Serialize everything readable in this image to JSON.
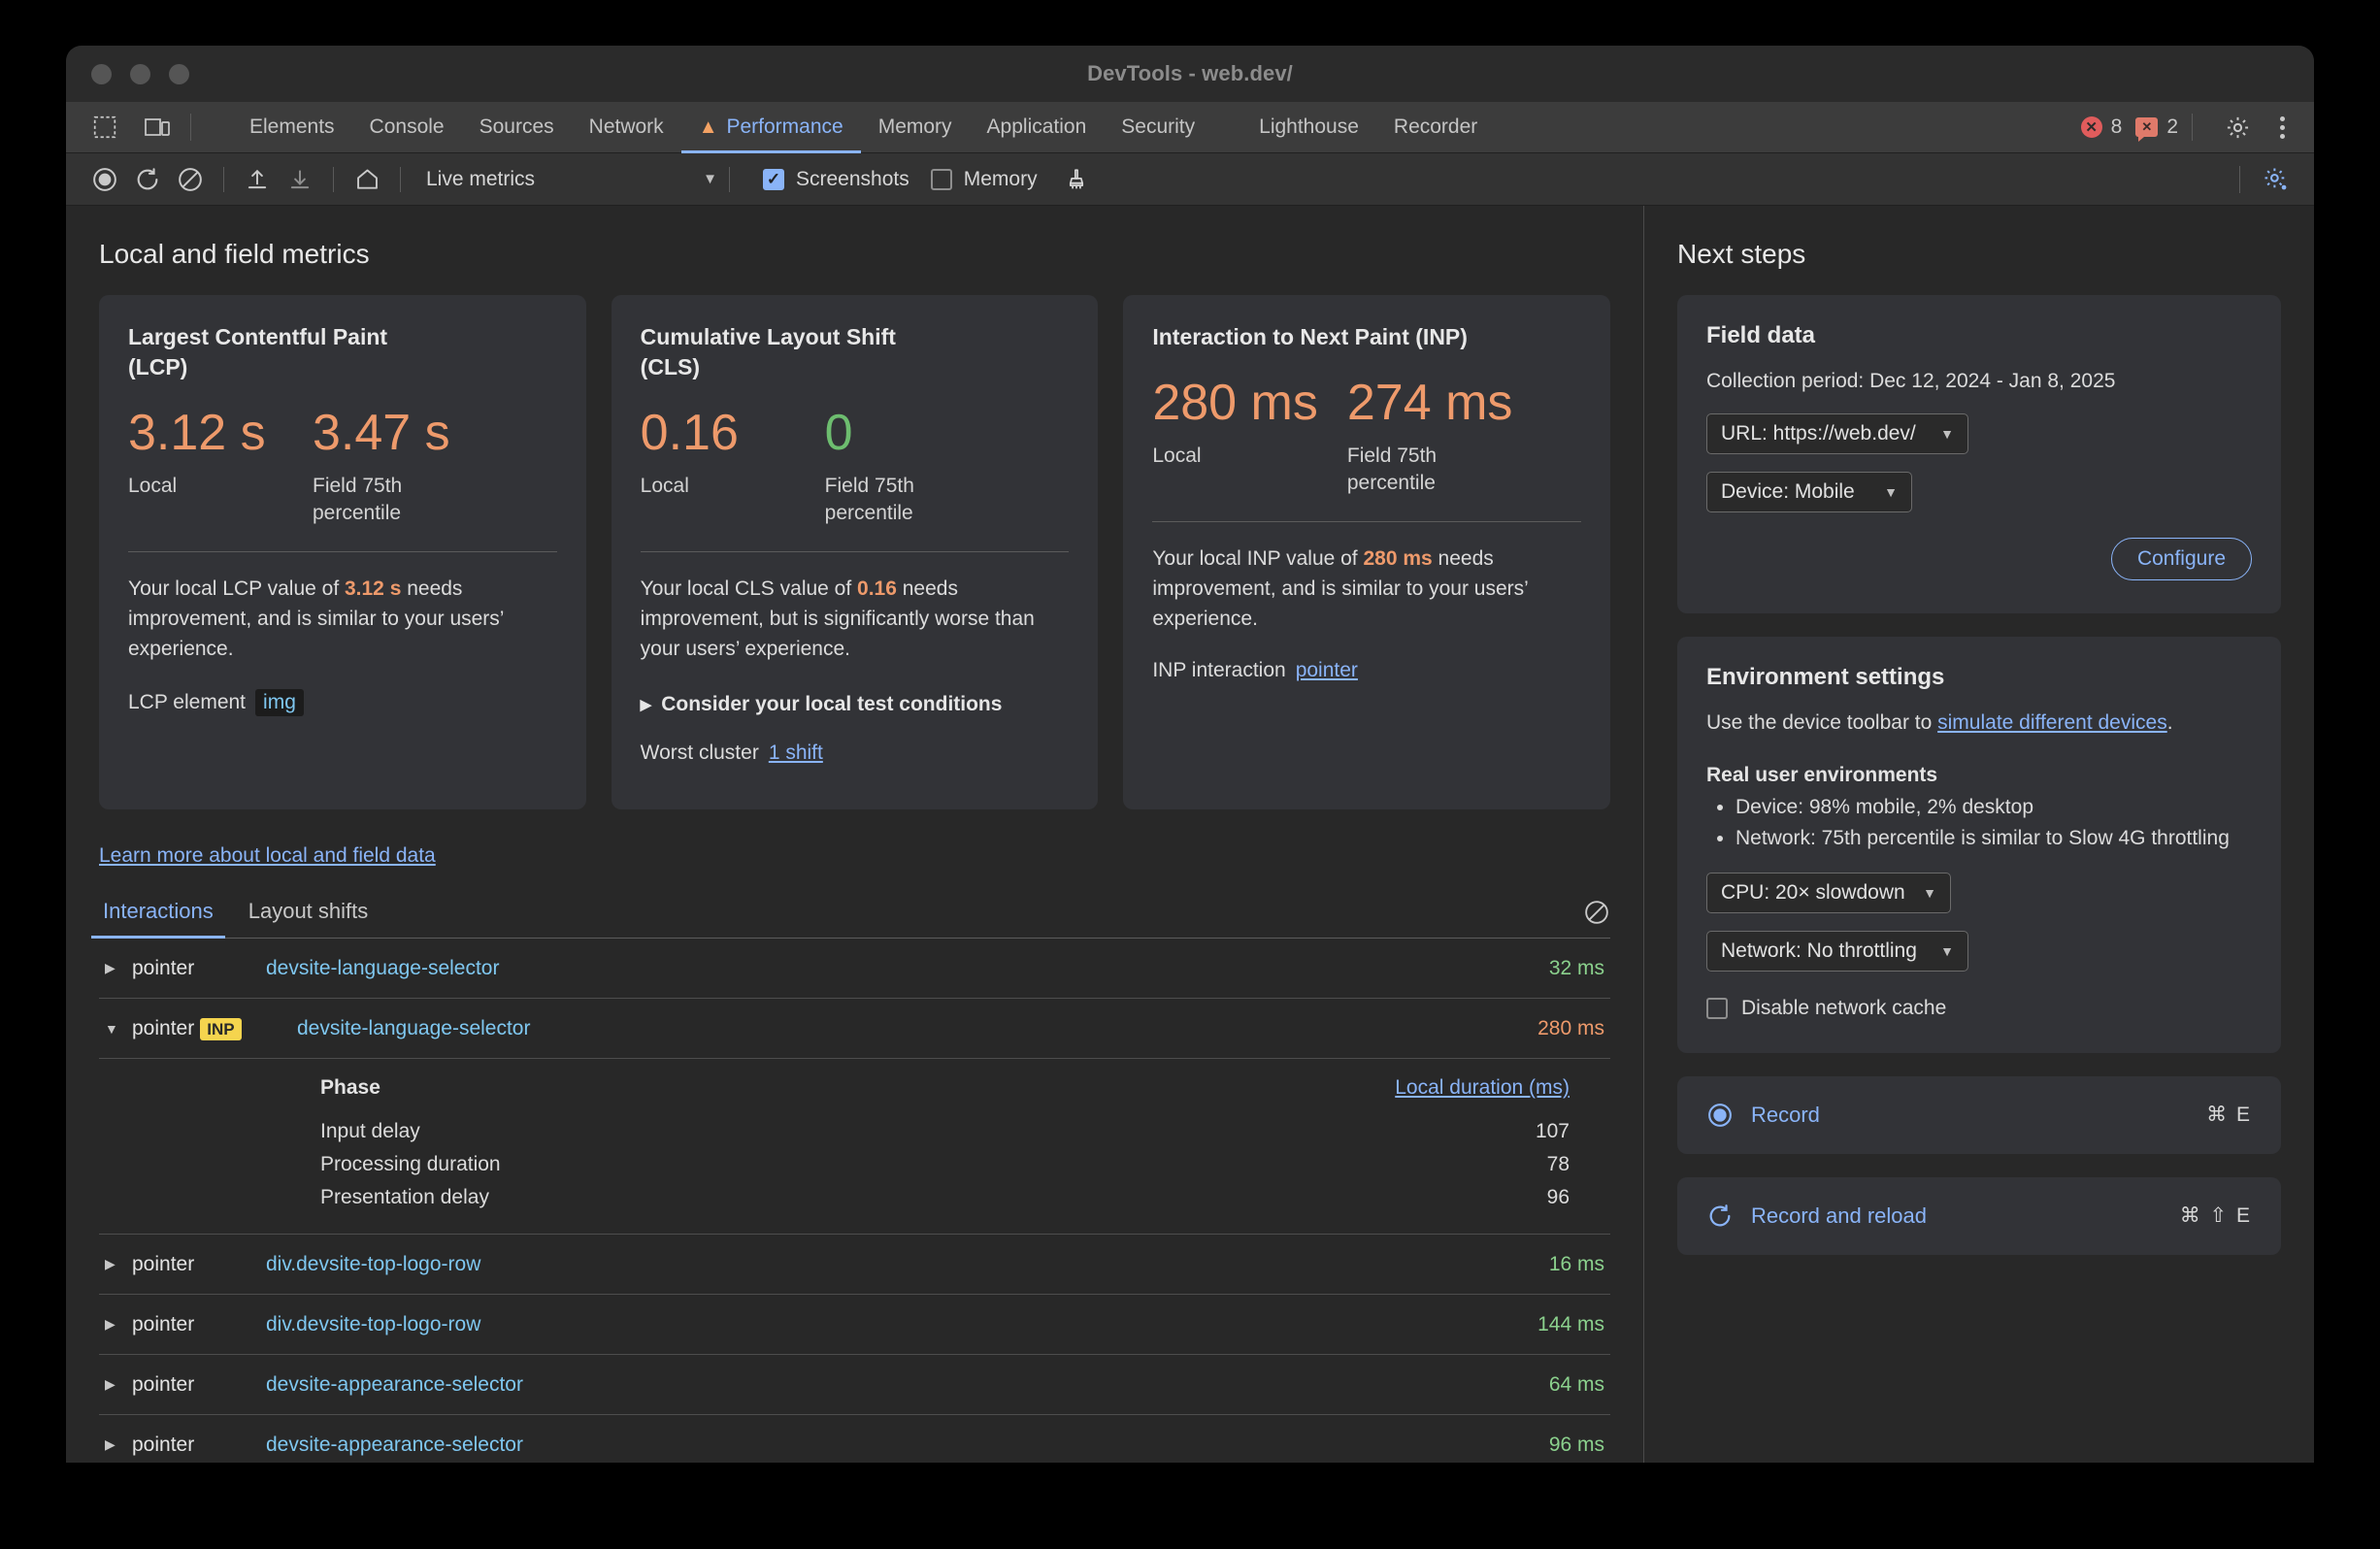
{
  "window": {
    "title": "DevTools - web.dev/"
  },
  "tabbar": {
    "inspect_icon": "inspect-icon",
    "device_icon": "device-toolbar-icon",
    "tabs": [
      {
        "label": "Elements",
        "active": false
      },
      {
        "label": "Console",
        "active": false
      },
      {
        "label": "Sources",
        "active": false
      },
      {
        "label": "Network",
        "active": false
      },
      {
        "label": "Performance",
        "active": true
      },
      {
        "label": "Memory",
        "active": false
      },
      {
        "label": "Application",
        "active": false
      },
      {
        "label": "Security",
        "active": false
      },
      {
        "label": "Lighthouse",
        "active": false
      },
      {
        "label": "Recorder",
        "active": false
      }
    ],
    "error_count": "8",
    "warning_count": "2",
    "settings_icon": "gear-icon",
    "more_icon": "kebab-menu-icon"
  },
  "toolbar": {
    "record_icon": "record-icon",
    "reload_icon": "record-and-reload-icon",
    "clear_icon": "clear-icon",
    "upload_icon": "upload-profile-icon",
    "download_icon": "download-profile-icon",
    "home_icon": "home-icon",
    "mode_label": "Live metrics",
    "screenshots_label": "Screenshots",
    "screenshots_checked": true,
    "memory_label": "Memory",
    "memory_checked": false,
    "brush_icon": "brush-icon",
    "settings_icon": "capture-settings-icon"
  },
  "main": {
    "heading": "Local and field metrics",
    "learn_more": "Learn more about local and field data",
    "cards": [
      {
        "title": "Largest Contentful Paint (LCP)",
        "local_value": "3.12 s",
        "local_label": "Local",
        "field_value": "3.47 s",
        "field_label": "Field 75th percentile",
        "local_color": "#ee9a6b",
        "field_color": "#ee9a6b",
        "desc_pre": "Your local LCP value of ",
        "desc_hl": "3.12 s",
        "desc_post": " needs improvement, and is similar to your users’ experience.",
        "footer_label": "LCP element",
        "footer_chip": "img"
      },
      {
        "title": "Cumulative Layout Shift (CLS)",
        "local_value": "0.16",
        "local_label": "Local",
        "field_value": "0",
        "field_label": "Field 75th percentile",
        "local_color": "#ee9a6b",
        "field_color": "#6dbd6f",
        "desc_pre": "Your local CLS value of ",
        "desc_hl": "0.16",
        "desc_post": " needs improvement, but is significantly worse than your users’ experience.",
        "disclosure": "Consider your local test conditions",
        "footer_label": "Worst cluster",
        "footer_link": "1 shift"
      },
      {
        "title": "Interaction to Next Paint (INP)",
        "local_value": "280 ms",
        "local_label": "Local",
        "field_value": "274 ms",
        "field_label": "Field 75th percentile",
        "local_color": "#ee9a6b",
        "field_color": "#ee9a6b",
        "desc_pre": "Your local INP value of ",
        "desc_hl": "280 ms",
        "desc_post": " needs improvement, and is similar to your users’ experience.",
        "footer_label": "INP interaction",
        "footer_link": "pointer"
      }
    ],
    "table": {
      "tabs": [
        {
          "label": "Interactions",
          "active": true
        },
        {
          "label": "Layout shifts",
          "active": false
        }
      ],
      "clear_icon": "clear-interactions-icon",
      "rows": [
        {
          "kind": "pointer",
          "badge": "",
          "selector": "devsite-language-selector",
          "duration": "32 ms",
          "tone": "green",
          "expanded": false
        },
        {
          "kind": "pointer",
          "badge": "INP",
          "selector": "devsite-language-selector",
          "duration": "280 ms",
          "tone": "orange",
          "expanded": true
        },
        {
          "kind": "pointer",
          "badge": "",
          "selector": "div.devsite-top-logo-row",
          "duration": "16 ms",
          "tone": "green",
          "expanded": false
        },
        {
          "kind": "pointer",
          "badge": "",
          "selector": "div.devsite-top-logo-row",
          "duration": "144 ms",
          "tone": "green",
          "expanded": false
        },
        {
          "kind": "pointer",
          "badge": "",
          "selector": "devsite-appearance-selector",
          "duration": "64 ms",
          "tone": "green",
          "expanded": false
        },
        {
          "kind": "pointer",
          "badge": "",
          "selector": "devsite-appearance-selector",
          "duration": "96 ms",
          "tone": "green",
          "expanded": false
        }
      ],
      "phase_header": {
        "phase": "Phase",
        "duration": "Local duration (ms)"
      },
      "phases": [
        {
          "name": "Input delay",
          "value": "107"
        },
        {
          "name": "Processing duration",
          "value": "78"
        },
        {
          "name": "Presentation delay",
          "value": "96"
        }
      ]
    }
  },
  "sidebar": {
    "heading": "Next steps",
    "field_data": {
      "title": "Field data",
      "collection_period": "Collection period: Dec 12, 2024 - Jan 8, 2025",
      "url_select": "URL: https://web.dev/",
      "device_select": "Device: Mobile",
      "configure_button": "Configure"
    },
    "environment": {
      "title": "Environment settings",
      "intro_pre": "Use the device toolbar to ",
      "intro_link": "simulate different devices",
      "intro_post": ".",
      "real_user_title": "Real user environments",
      "bullets": [
        "Device: 98% mobile, 2% desktop",
        "Network: 75th percentile is similar to Slow 4G throttling"
      ],
      "cpu_select": "CPU: 20× slowdown",
      "network_select": "Network: No throttling",
      "disable_cache_label": "Disable network cache",
      "disable_cache_checked": false
    },
    "actions": [
      {
        "icon": "record-icon",
        "label": "Record",
        "shortcut": "⌘ E"
      },
      {
        "icon": "record-and-reload-icon",
        "label": "Record and reload",
        "shortcut": "⌘ ⇧ E"
      }
    ]
  }
}
